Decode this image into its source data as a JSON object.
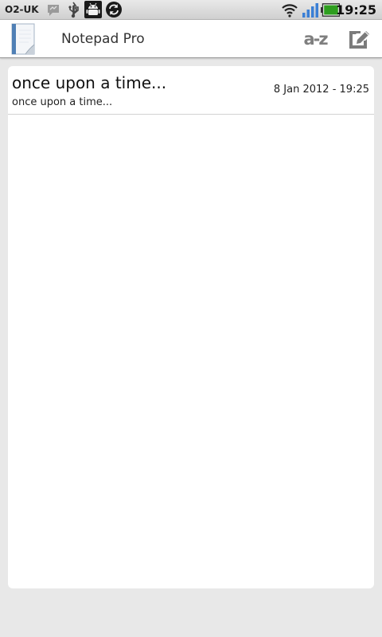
{
  "status_bar": {
    "carrier": "O2-UK",
    "time": "19:25",
    "icons": [
      "message-icon",
      "usb-icon",
      "android-debug-icon",
      "sync-icon",
      "wifi-icon",
      "signal-icon",
      "battery-icon"
    ],
    "battery_color": "#2e9e1f",
    "signal_color": "#3a7fd5"
  },
  "app_bar": {
    "title": "Notepad Pro",
    "sort_label": "a-z",
    "icons": [
      "notepad-icon",
      "sort-az-icon",
      "new-note-icon"
    ]
  },
  "notes": [
    {
      "title": "once upon a time...",
      "preview": "once upon a time...",
      "date": "8 Jan 2012 - 19:25"
    }
  ]
}
